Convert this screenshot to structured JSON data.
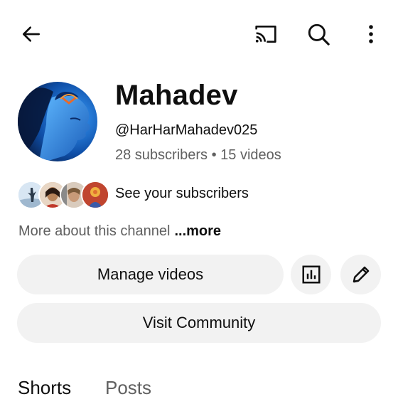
{
  "header": {
    "back_icon": "arrow-left-icon",
    "cast_icon": "cast-icon",
    "search_icon": "search-icon",
    "more_icon": "more-vert-icon"
  },
  "channel": {
    "name": "Mahadev",
    "handle": "@HarHarMahadev025",
    "stats": "28 subscribers • 15 videos",
    "subscribers_link": "See your subscribers",
    "about_text": "More about this channel",
    "about_more": "...more"
  },
  "actions": {
    "manage_videos": "Manage videos",
    "analytics_icon": "analytics-icon",
    "edit_icon": "pencil-icon",
    "visit_community": "Visit Community"
  },
  "tabs": [
    {
      "label": "Shorts",
      "selected": true
    },
    {
      "label": "Posts",
      "selected": false
    }
  ],
  "colors": {
    "secondary_text": "#606060",
    "button_bg": "#f2f2f2"
  }
}
